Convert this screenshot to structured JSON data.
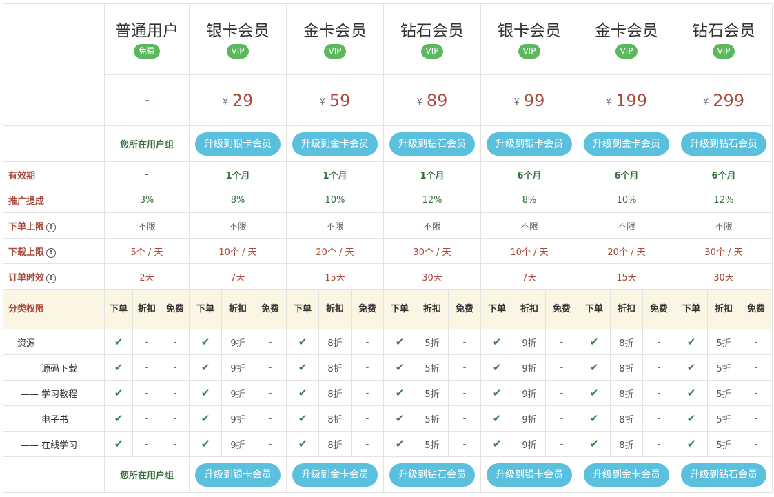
{
  "plans": [
    {
      "name": "普通用户",
      "badge": "免费",
      "price": "-"
    },
    {
      "name": "银卡会员",
      "badge": "VIP",
      "currency": "¥",
      "price": "29"
    },
    {
      "name": "金卡会员",
      "badge": "VIP",
      "currency": "¥",
      "price": "59"
    },
    {
      "name": "钻石会员",
      "badge": "VIP",
      "currency": "¥",
      "price": "89"
    },
    {
      "name": "银卡会员",
      "badge": "VIP",
      "currency": "¥",
      "price": "99"
    },
    {
      "name": "金卡会员",
      "badge": "VIP",
      "currency": "¥",
      "price": "199"
    },
    {
      "name": "钻石会员",
      "badge": "VIP",
      "currency": "¥",
      "price": "299"
    }
  ],
  "current_group_label": "您所在用户组",
  "upgrade_buttons": [
    "升级到银卡会员",
    "升级到金卡会员",
    "升级到钻石会员",
    "升级到银卡会员",
    "升级到金卡会员",
    "升级到钻石会员"
  ],
  "rows": {
    "validity": {
      "label": "有效期",
      "values": [
        "-",
        "1个月",
        "1个月",
        "1个月",
        "6个月",
        "6个月",
        "6个月"
      ]
    },
    "commission": {
      "label": "推广提成",
      "values": [
        "3%",
        "8%",
        "10%",
        "12%",
        "8%",
        "10%",
        "12%"
      ]
    },
    "order_limit": {
      "label": "下单上限",
      "values": [
        "不限",
        "不限",
        "不限",
        "不限",
        "不限",
        "不限",
        "不限"
      ]
    },
    "download_limit": {
      "label": "下载上限",
      "values": [
        "5个 / 天",
        "10个 / 天",
        "20个 / 天",
        "30个 / 天",
        "10个 / 天",
        "20个 / 天",
        "30个 / 天"
      ]
    },
    "order_timeout": {
      "label": "订单时效",
      "values": [
        "2天",
        "7天",
        "15天",
        "30天",
        "7天",
        "15天",
        "30天"
      ]
    }
  },
  "info_icon": "info-circle-icon",
  "permissions": {
    "label": "分类权限",
    "headers": [
      "下单",
      "折扣",
      "免费"
    ],
    "categories": [
      {
        "name": "资源",
        "discounts": [
          "9折",
          "8折",
          "5折",
          "9折",
          "8折",
          "5折"
        ]
      },
      {
        "name": "—— 源码下载",
        "discounts": [
          "9折",
          "8折",
          "5折",
          "9折",
          "8折",
          "5折"
        ]
      },
      {
        "name": "—— 学习教程",
        "discounts": [
          "9折",
          "8折",
          "5折",
          "9折",
          "8折",
          "5折"
        ]
      },
      {
        "name": "—— 电子书",
        "discounts": [
          "9折",
          "8折",
          "5折",
          "9折",
          "8折",
          "5折"
        ]
      },
      {
        "name": "—— 在线学习",
        "discounts": [
          "9折",
          "8折",
          "5折",
          "9折",
          "8折",
          "5折"
        ]
      }
    ],
    "none_mark": "-",
    "check_icon": "check-icon"
  },
  "colors": {
    "accent_green": "#5cb85c",
    "button_blue": "#5bc0de",
    "price_red": "#a84a3c",
    "sub_header_bg": "#fbf6e3"
  }
}
